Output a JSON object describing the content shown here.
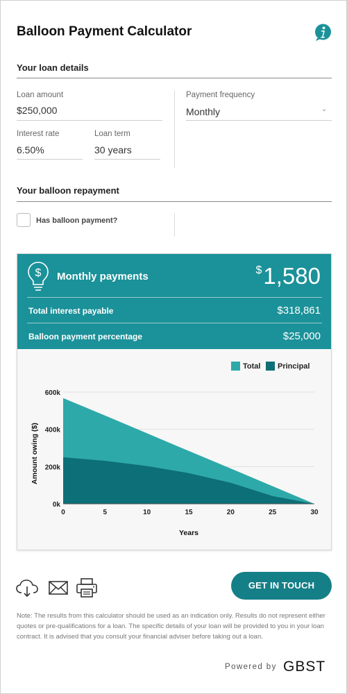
{
  "title": "Balloon Payment Calculator",
  "loan_details": {
    "heading": "Your loan details",
    "loan_amount": {
      "label": "Loan amount",
      "value": "$250,000"
    },
    "payment_frequency": {
      "label": "Payment frequency",
      "value": "Monthly"
    },
    "interest_rate": {
      "label": "Interest rate",
      "value": "6.50%"
    },
    "loan_term": {
      "label": "Loan term",
      "value": "30 years"
    }
  },
  "balloon": {
    "heading": "Your balloon repayment",
    "checkbox_label": "Has balloon payment?",
    "checked": false
  },
  "results": {
    "monthly_label": "Monthly payments",
    "currency_symbol": "$",
    "monthly_amount": "1,580",
    "total_interest_label": "Total interest payable",
    "total_interest_value": "$318,861",
    "balloon_pct_label": "Balloon payment percentage",
    "balloon_pct_value": "$25,000"
  },
  "legend": {
    "total": "Total",
    "principal": "Principal"
  },
  "colors": {
    "accent": "#1b9199",
    "total_area": "#2ea9a9",
    "principal_area": "#0d6f78",
    "button": "#157f87"
  },
  "chart_data": {
    "type": "area",
    "xlabel": "Years",
    "ylabel": "Amount owing ($)",
    "x": [
      0,
      5,
      10,
      15,
      20,
      25,
      30
    ],
    "xticks": [
      "0",
      "5",
      "10",
      "15",
      "20",
      "25",
      "30"
    ],
    "yticks": [
      "600k",
      "400k",
      "200k",
      "0k"
    ],
    "ytick_values": [
      600000,
      400000,
      200000,
      0
    ],
    "ylim": [
      0,
      600000
    ],
    "xlim": [
      0,
      30
    ],
    "series": [
      {
        "name": "Total",
        "values": [
          568000,
          474000,
          379000,
          284000,
          190000,
          95000,
          0
        ]
      },
      {
        "name": "Principal",
        "values": [
          250000,
          231000,
          203000,
          165000,
          113000,
          42000,
          0
        ]
      }
    ],
    "grid": true,
    "legend_position": "top-right"
  },
  "actions": {
    "download_icon": "cloud-download-icon",
    "email_icon": "envelope-icon",
    "print_icon": "printer-icon",
    "cta_label": "GET IN TOUCH"
  },
  "note": "Note: The results from this calculator should be used as an indication only. Results do not represent either quotes or pre-qualifications for a loan. The specific details of your loan will be provided to you in your loan contract. It is advised that you consult your financial adviser before taking out a loan.",
  "footer": {
    "powered_by": "Powered by",
    "brand": "GBST"
  }
}
